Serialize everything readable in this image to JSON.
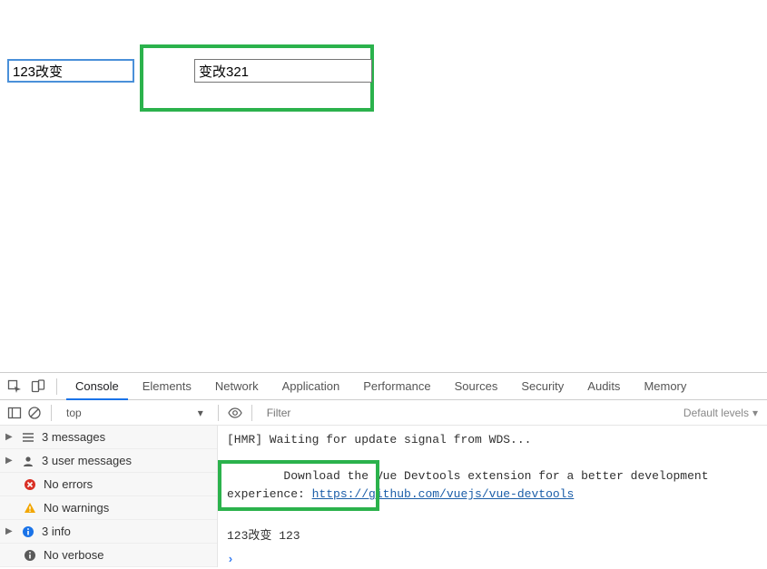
{
  "page": {
    "input_a": "123改变",
    "input_b": "变改321"
  },
  "devtools": {
    "tabs": [
      "Console",
      "Elements",
      "Network",
      "Application",
      "Performance",
      "Sources",
      "Security",
      "Audits",
      "Memory"
    ],
    "active_tab_index": 0,
    "toolbar": {
      "context": "top",
      "filter_placeholder": "Filter",
      "levels_label": "Default levels"
    },
    "sidebar": {
      "items": [
        {
          "label": "3 messages",
          "kind": "messages",
          "child": false,
          "expandable": true
        },
        {
          "label": "3 user messages",
          "kind": "user",
          "child": false,
          "expandable": true
        },
        {
          "label": "No errors",
          "kind": "error",
          "child": true,
          "expandable": false
        },
        {
          "label": "No warnings",
          "kind": "warning",
          "child": true,
          "expandable": false
        },
        {
          "label": "3 info",
          "kind": "info",
          "child": false,
          "expandable": true
        },
        {
          "label": "No verbose",
          "kind": "verbose",
          "child": true,
          "expandable": false
        }
      ]
    },
    "console": {
      "line1": "[HMR] Waiting for update signal from WDS...",
      "line2_pre": "Download the Vue Devtools extension for a better development experience: ",
      "line2_link": "https://github.com/vuejs/vue-devtools",
      "line3": "123改变 123"
    }
  }
}
